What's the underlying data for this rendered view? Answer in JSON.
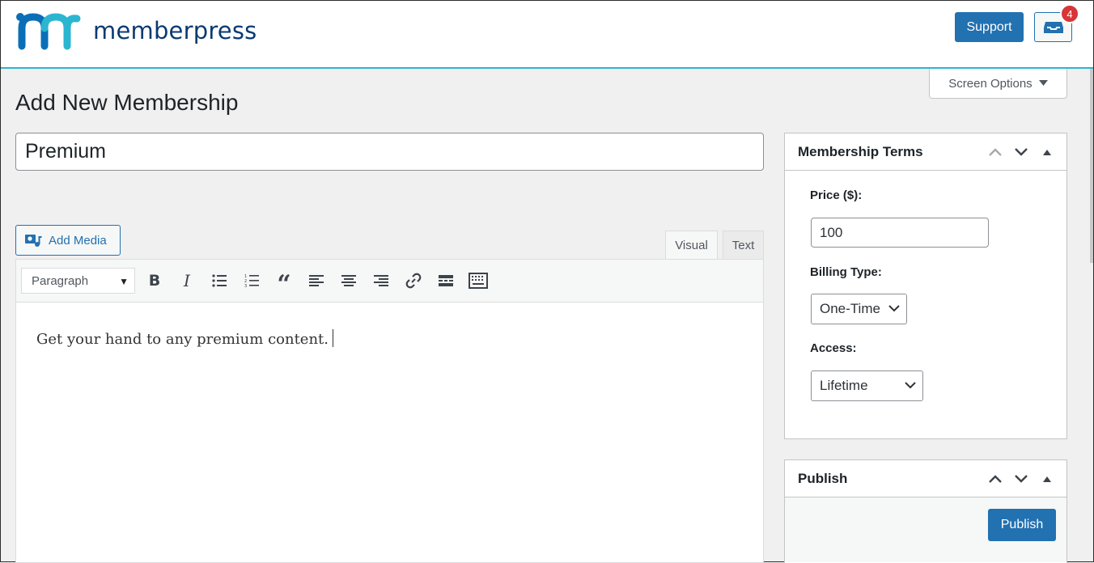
{
  "brand": {
    "name": "memberpress"
  },
  "header": {
    "support_label": "Support",
    "inbox_count": "4",
    "inbox_icon": "inbox-icon"
  },
  "screen_options": {
    "label": "Screen Options"
  },
  "page": {
    "title": "Add New Membership"
  },
  "post": {
    "title_value": "Premium"
  },
  "editor": {
    "add_media_label": "Add Media",
    "tabs": [
      {
        "label": "Visual",
        "active": true
      },
      {
        "label": "Text",
        "active": false
      }
    ],
    "format_select_value": "Paragraph",
    "toolbar_icons": [
      "bold-icon",
      "italic-icon",
      "bulleted-list-icon",
      "numbered-list-icon",
      "blockquote-icon",
      "align-left-icon",
      "align-center-icon",
      "align-right-icon",
      "link-icon",
      "read-more-icon",
      "toolbar-toggle-icon"
    ],
    "content": "Get your hand to any premium content."
  },
  "membership_terms": {
    "title": "Membership Terms",
    "price_label": "Price ($):",
    "price_value": "100",
    "billing_label": "Billing Type:",
    "billing_value": "One-Time",
    "access_label": "Access:",
    "access_value": "Lifetime"
  },
  "publish_box": {
    "title": "Publish",
    "publish_label": "Publish"
  },
  "colors": {
    "accent": "#2271b1",
    "header_border": "#2bb5d0",
    "badge": "#d63638",
    "brand_dark": "#0b3a72",
    "brand_teal": "#2bb5d0"
  }
}
